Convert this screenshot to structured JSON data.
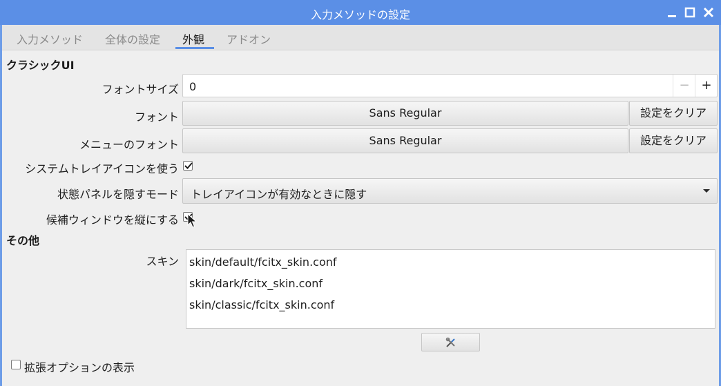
{
  "window": {
    "title": "入力メソッドの設定"
  },
  "tabs": [
    {
      "label": "入力メソッド",
      "active": false
    },
    {
      "label": "全体の設定",
      "active": false
    },
    {
      "label": "外観",
      "active": true
    },
    {
      "label": "アドオン",
      "active": false
    }
  ],
  "classic_ui": {
    "section_title": "クラシックUI",
    "font_size": {
      "label": "フォントサイズ",
      "value": "0",
      "minus": "−",
      "plus": "+"
    },
    "font": {
      "label": "フォント",
      "value": "Sans Regular",
      "clear_label": "設定をクリア"
    },
    "menu_font": {
      "label": "メニューのフォント",
      "value": "Sans Regular",
      "clear_label": "設定をクリア"
    },
    "tray_icon": {
      "label": "システムトレイアイコンを使う",
      "checked": true
    },
    "hide_panel_mode": {
      "label": "状態パネルを隠すモード",
      "value": "トレイアイコンが有効なときに隠す"
    },
    "vertical_candidate": {
      "label": "候補ウィンドウを縦にする",
      "checked": true
    }
  },
  "other": {
    "section_title": "その他",
    "skin": {
      "label": "スキン",
      "items": [
        "skin/default/fcitx_skin.conf",
        "skin/dark/fcitx_skin.conf",
        "skin/classic/fcitx_skin.conf"
      ]
    }
  },
  "advanced": {
    "label": "拡張オプションの表示",
    "checked": false
  },
  "colors": {
    "accent": "#5b8fe6",
    "background": "#efefef"
  }
}
